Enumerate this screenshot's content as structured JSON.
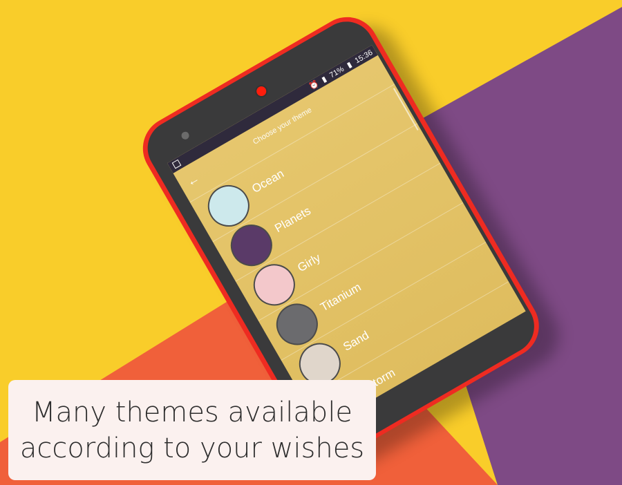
{
  "background": {
    "yellow": "#f9cd2a",
    "purple": "#7e4a85",
    "orange": "#f0603a"
  },
  "status_bar": {
    "battery": "71%",
    "time": "15:36",
    "icons": [
      "image-icon",
      "alarm-icon",
      "no-signal-icon",
      "wifi-icon",
      "signal-icon",
      "battery-icon"
    ]
  },
  "header": {
    "back_icon": "arrow-left-icon",
    "back_glyph": "←",
    "title": "Choose your theme"
  },
  "themes": [
    {
      "label": "Ocean",
      "color": "#cde9ec"
    },
    {
      "label": "Planets",
      "color": "#5a3a68"
    },
    {
      "label": "Girly",
      "color": "#f3c8cb"
    },
    {
      "label": "Titanium",
      "color": "#6b6b6e"
    },
    {
      "label": "Sand",
      "color": "#e0d6cb"
    },
    {
      "label": "Storm",
      "color": "#1f5a76"
    }
  ],
  "caption": {
    "line1": "Many themes available",
    "line2": "according to your wishes"
  }
}
